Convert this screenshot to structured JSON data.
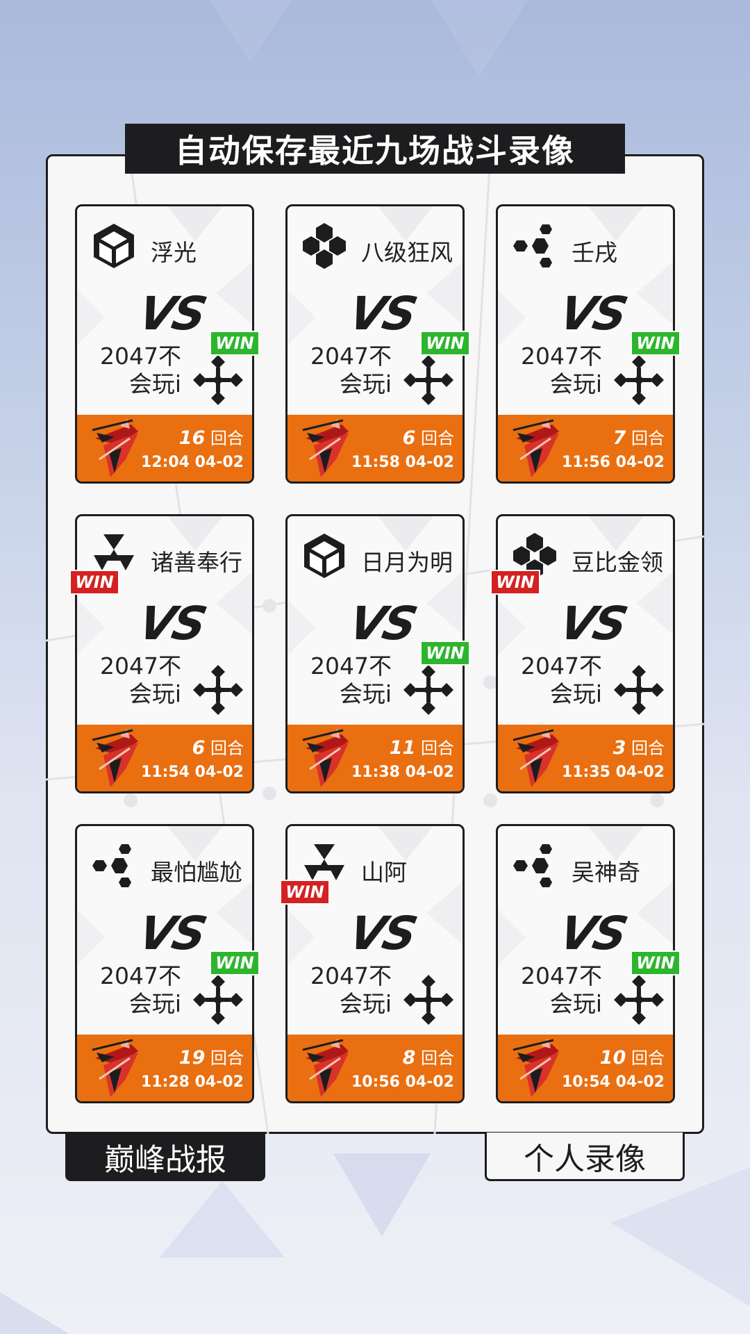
{
  "title": "自动保存最近九场战斗录像",
  "vs_label": "VS",
  "self_name": "2047不会玩i",
  "self_name_line1": "2047不",
  "self_name_line2": "会玩i",
  "rounds_unit": "回合",
  "win_label": "WIN",
  "matches": [
    {
      "opponent": "浮光",
      "opp_icon": "cube-icon",
      "rounds": "16",
      "time": "12:04 04-02",
      "winner": "self"
    },
    {
      "opponent": "八级狂风",
      "opp_icon": "quad-hex-icon",
      "rounds": "6",
      "time": "11:58 04-02",
      "winner": "self"
    },
    {
      "opponent": "壬戌",
      "opp_icon": "hex-cluster-icon",
      "rounds": "7",
      "time": "11:56 04-02",
      "winner": "self"
    },
    {
      "opponent": "诸善奉行",
      "opp_icon": "triangles-icon",
      "rounds": "6",
      "time": "11:54 04-02",
      "winner": "opponent"
    },
    {
      "opponent": "日月为明",
      "opp_icon": "cube-icon",
      "rounds": "11",
      "time": "11:38 04-02",
      "winner": "self"
    },
    {
      "opponent": "豆比金领",
      "opp_icon": "quad-hex-icon",
      "rounds": "3",
      "time": "11:35 04-02",
      "winner": "opponent"
    },
    {
      "opponent": "最怕尴尬",
      "opp_icon": "hex-cluster-icon",
      "rounds": "19",
      "time": "11:28 04-02",
      "winner": "self"
    },
    {
      "opponent": "山阿",
      "opp_icon": "triangles-icon",
      "rounds": "8",
      "time": "10:56 04-02",
      "winner": "opponent"
    },
    {
      "opponent": "吴神奇",
      "opp_icon": "hex-cluster-icon",
      "rounds": "10",
      "time": "10:54 04-02",
      "winner": "self"
    }
  ],
  "self_icon": "diamond-cross-icon",
  "mech_icon": "mech-icon",
  "tabs": {
    "left": "巅峰战报",
    "right": "个人录像"
  },
  "colors": {
    "accent": "#e96f11",
    "dark": "#1d1d1f",
    "win_green": "#2db52d",
    "win_red": "#d42121"
  }
}
